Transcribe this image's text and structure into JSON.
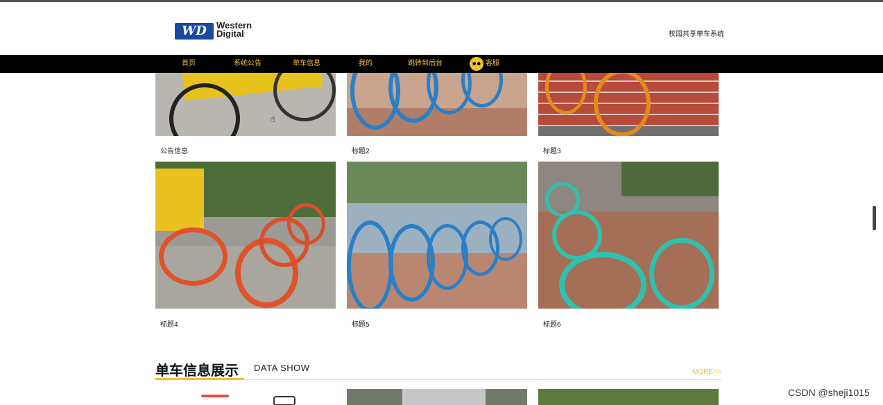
{
  "header": {
    "logo_line1": "Western",
    "logo_line2": "Digital",
    "logo_badge": "WD",
    "site_name": "校园共享单车系统"
  },
  "nav": {
    "items": [
      "首页",
      "系统公告",
      "单车信息",
      "我的",
      "跳转到后台",
      "客服"
    ]
  },
  "announcements": {
    "cards": [
      {
        "title": "公告信息"
      },
      {
        "title": "标题2"
      },
      {
        "title": "标题3"
      },
      {
        "title": "标题4"
      },
      {
        "title": "标题5"
      },
      {
        "title": "标题6"
      }
    ]
  },
  "bike_section": {
    "title": "单车信息展示",
    "subtitle": "DATA SHOW",
    "more": "MORE>>"
  },
  "watermark": "CSDN @sheji1015",
  "colors": {
    "accent": "#f2c12e",
    "navbar": "#000000",
    "logo_blue": "#1a4aa0"
  }
}
